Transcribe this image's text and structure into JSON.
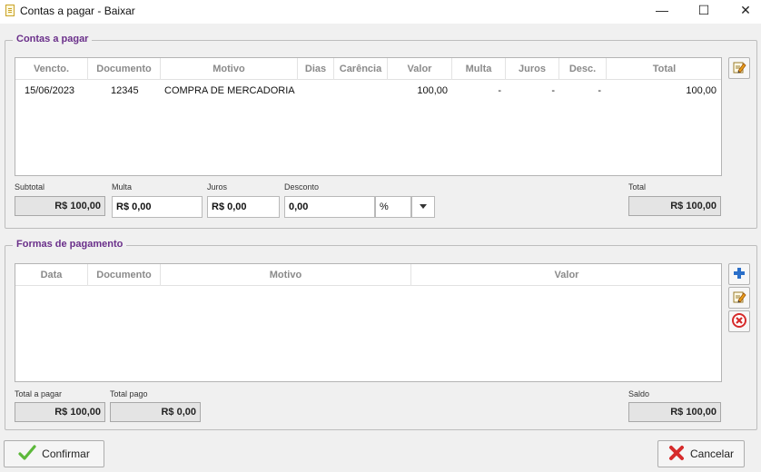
{
  "window": {
    "title": "Contas a pagar - Baixar",
    "minimize_glyph": "—",
    "maximize_glyph": "☐",
    "close_glyph": "✕"
  },
  "contas_a_pagar": {
    "legend": "Contas a pagar",
    "columns": [
      "Vencto.",
      "Documento",
      "Motivo",
      "Dias",
      "Carência",
      "Valor",
      "Multa",
      "Juros",
      "Desc.",
      "Total"
    ],
    "rows": [
      {
        "vencto": "15/06/2023",
        "documento": "12345",
        "motivo": "COMPRA DE MERCADORIA",
        "dias": "",
        "carencia": "",
        "valor": "100,00",
        "multa": "-",
        "juros": "-",
        "desc": "-",
        "total": "100,00"
      }
    ],
    "subtotal_label": "Subtotal",
    "subtotal_value": "R$ 100,00",
    "multa_label": "Multa",
    "multa_value": "R$ 0,00",
    "juros_label": "Juros",
    "juros_value": "R$ 0,00",
    "desconto_label": "Desconto",
    "desconto_value": "0,00",
    "desconto_tipo": "%",
    "total_label": "Total",
    "total_value": "R$ 100,00",
    "edit_icon": "edit-icon"
  },
  "formas_pagamento": {
    "legend": "Formas de pagamento",
    "columns": [
      "Data",
      "Documento",
      "Motivo",
      "Valor"
    ],
    "total_a_pagar_label": "Total a pagar",
    "total_a_pagar_value": "R$ 100,00",
    "total_pago_label": "Total pago",
    "total_pago_value": "R$ 0,00",
    "saldo_label": "Saldo",
    "saldo_value": "R$ 100,00",
    "icons": [
      "add-icon",
      "edit-icon",
      "delete-icon"
    ]
  },
  "footer": {
    "confirmar_label": "Confirmar",
    "cancelar_label": "Cancelar"
  },
  "colors": {
    "legend_purple": "#6a2f8a",
    "add_blue": "#2a6fc9",
    "delete_red": "#d62b2b",
    "confirm_green": "#5cb83a"
  }
}
